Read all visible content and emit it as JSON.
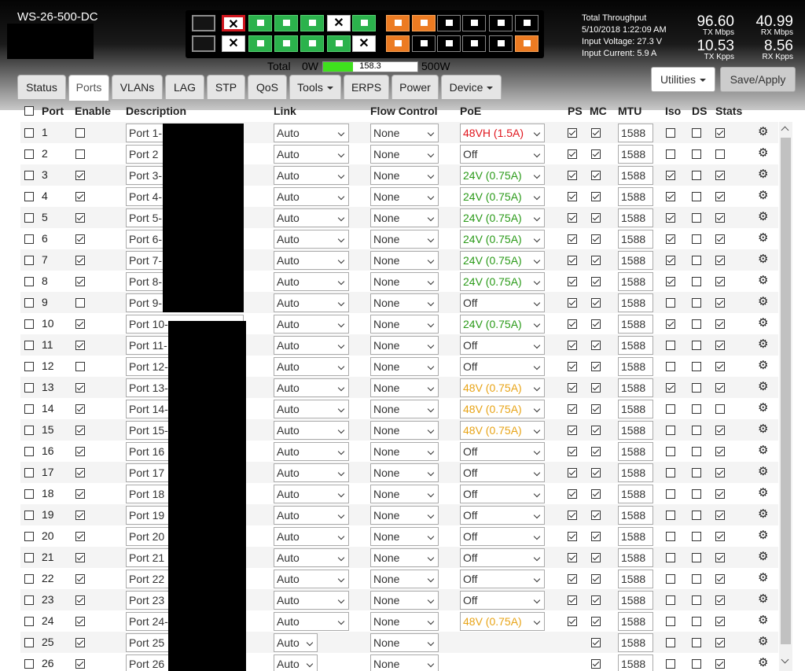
{
  "device": {
    "name": "WS-26-500-DC"
  },
  "port_icons": {
    "top": [
      "off",
      "x-red",
      "green",
      "green",
      "green",
      "x",
      "green",
      "orange",
      "orange",
      "black",
      "black",
      "black",
      "black"
    ],
    "bottom": [
      "off",
      "x",
      "green",
      "green",
      "green",
      "green",
      "x",
      "orange",
      "black",
      "black",
      "black",
      "black",
      "orange"
    ]
  },
  "power": {
    "total_label": "Total",
    "min_label": "0W",
    "value": "158.3",
    "max_label": "500W",
    "fraction": 0.3166
  },
  "throughput": {
    "title": "Total Throughput",
    "datetime": "5/10/2018 1:22:09 AM",
    "voltage": "Input Voltage: 27.3 V",
    "current": "Input Current: 5.9 A",
    "tx_mbps": "96.60",
    "tx_mbps_unit": "TX Mbps",
    "rx_mbps": "40.99",
    "rx_mbps_unit": "RX Mbps",
    "tx_kpps": "10.53",
    "tx_kpps_unit": "TX Kpps",
    "rx_kpps": "8.56",
    "rx_kpps_unit": "RX Kpps"
  },
  "buttons": {
    "utilities": "Utilities",
    "save": "Save/Apply"
  },
  "tabs": [
    {
      "label": "Status",
      "dropdown": false,
      "active": false
    },
    {
      "label": "Ports",
      "dropdown": false,
      "active": true
    },
    {
      "label": "VLANs",
      "dropdown": false,
      "active": false
    },
    {
      "label": "LAG",
      "dropdown": false,
      "active": false
    },
    {
      "label": "STP",
      "dropdown": false,
      "active": false
    },
    {
      "label": "QoS",
      "dropdown": false,
      "active": false
    },
    {
      "label": "Tools",
      "dropdown": true,
      "active": false
    },
    {
      "label": "ERPS",
      "dropdown": false,
      "active": false
    },
    {
      "label": "Power",
      "dropdown": false,
      "active": false
    },
    {
      "label": "Device",
      "dropdown": true,
      "active": false
    }
  ],
  "columns": {
    "port": "Port",
    "enable": "Enable",
    "description": "Description",
    "link": "Link",
    "flow": "Flow Control",
    "poe": "PoE",
    "ps": "PS",
    "mc": "MC",
    "mtu": "MTU",
    "iso": "Iso",
    "ds": "DS",
    "stats": "Stats"
  },
  "colors": {
    "poe_red": "#e0161e",
    "poe_green": "#2a9a18",
    "poe_amber": "#e8a417",
    "poe_off": "#333333"
  },
  "ports": [
    {
      "n": "1",
      "en": false,
      "desc": "Port 1-",
      "link": "Auto",
      "flow": "None",
      "poe": "48VH (1.5A)",
      "poe_c": "red",
      "ps": true,
      "mc": true,
      "mtu": "1588",
      "iso": false,
      "ds": false,
      "st": true
    },
    {
      "n": "2",
      "en": false,
      "desc": "Port 2",
      "link": "Auto",
      "flow": "None",
      "poe": "Off",
      "poe_c": "off",
      "ps": true,
      "mc": true,
      "mtu": "1588",
      "iso": false,
      "ds": false,
      "st": false
    },
    {
      "n": "3",
      "en": true,
      "desc": "Port 3-",
      "link": "Auto",
      "flow": "None",
      "poe": "24V (0.75A)",
      "poe_c": "green",
      "ps": true,
      "mc": true,
      "mtu": "1588",
      "iso": true,
      "ds": false,
      "st": true
    },
    {
      "n": "4",
      "en": true,
      "desc": "Port 4-",
      "link": "Auto",
      "flow": "None",
      "poe": "24V (0.75A)",
      "poe_c": "green",
      "ps": true,
      "mc": true,
      "mtu": "1588",
      "iso": true,
      "ds": false,
      "st": true
    },
    {
      "n": "5",
      "en": true,
      "desc": "Port 5-",
      "link": "Auto",
      "flow": "None",
      "poe": "24V (0.75A)",
      "poe_c": "green",
      "ps": true,
      "mc": true,
      "mtu": "1588",
      "iso": true,
      "ds": false,
      "st": true
    },
    {
      "n": "6",
      "en": true,
      "desc": "Port 6-",
      "link": "Auto",
      "flow": "None",
      "poe": "24V (0.75A)",
      "poe_c": "green",
      "ps": true,
      "mc": true,
      "mtu": "1588",
      "iso": true,
      "ds": false,
      "st": true
    },
    {
      "n": "7",
      "en": true,
      "desc": "Port 7-",
      "link": "Auto",
      "flow": "None",
      "poe": "24V (0.75A)",
      "poe_c": "green",
      "ps": true,
      "mc": true,
      "mtu": "1588",
      "iso": true,
      "ds": false,
      "st": true
    },
    {
      "n": "8",
      "en": true,
      "desc": "Port 8-",
      "link": "Auto",
      "flow": "None",
      "poe": "24V (0.75A)",
      "poe_c": "green",
      "ps": true,
      "mc": true,
      "mtu": "1588",
      "iso": true,
      "ds": false,
      "st": true
    },
    {
      "n": "9",
      "en": false,
      "desc": "Port 9-",
      "link": "Auto",
      "flow": "None",
      "poe": "Off",
      "poe_c": "off",
      "ps": true,
      "mc": true,
      "mtu": "1588",
      "iso": false,
      "ds": false,
      "st": true
    },
    {
      "n": "10",
      "en": true,
      "desc": "Port 10-",
      "link": "Auto",
      "flow": "None",
      "poe": "24V (0.75A)",
      "poe_c": "green",
      "ps": true,
      "mc": true,
      "mtu": "1588",
      "iso": true,
      "ds": false,
      "st": true
    },
    {
      "n": "11",
      "en": true,
      "desc": "Port 11-",
      "link": "Auto",
      "flow": "None",
      "poe": "Off",
      "poe_c": "off",
      "ps": true,
      "mc": true,
      "mtu": "1588",
      "iso": false,
      "ds": false,
      "st": true
    },
    {
      "n": "12",
      "en": false,
      "desc": "Port 12-",
      "link": "Auto",
      "flow": "None",
      "poe": "Off",
      "poe_c": "off",
      "ps": true,
      "mc": true,
      "mtu": "1588",
      "iso": false,
      "ds": false,
      "st": true
    },
    {
      "n": "13",
      "en": true,
      "desc": "Port 13-",
      "link": "Auto",
      "flow": "None",
      "poe": "48V (0.75A)",
      "poe_c": "amber",
      "ps": true,
      "mc": true,
      "mtu": "1588",
      "iso": true,
      "ds": false,
      "st": true
    },
    {
      "n": "14",
      "en": true,
      "desc": "Port 14-",
      "link": "Auto",
      "flow": "None",
      "poe": "48V (0.75A)",
      "poe_c": "amber",
      "ps": true,
      "mc": true,
      "mtu": "1588",
      "iso": false,
      "ds": false,
      "st": false
    },
    {
      "n": "15",
      "en": true,
      "desc": "Port 15-",
      "link": "Auto",
      "flow": "None",
      "poe": "48V (0.75A)",
      "poe_c": "amber",
      "ps": true,
      "mc": true,
      "mtu": "1588",
      "iso": false,
      "ds": false,
      "st": true
    },
    {
      "n": "16",
      "en": true,
      "desc": "Port 16",
      "link": "Auto",
      "flow": "None",
      "poe": "Off",
      "poe_c": "off",
      "ps": true,
      "mc": true,
      "mtu": "1588",
      "iso": false,
      "ds": false,
      "st": true
    },
    {
      "n": "17",
      "en": true,
      "desc": "Port 17",
      "link": "Auto",
      "flow": "None",
      "poe": "Off",
      "poe_c": "off",
      "ps": true,
      "mc": true,
      "mtu": "1588",
      "iso": false,
      "ds": false,
      "st": true
    },
    {
      "n": "18",
      "en": true,
      "desc": "Port 18",
      "link": "Auto",
      "flow": "None",
      "poe": "Off",
      "poe_c": "off",
      "ps": true,
      "mc": true,
      "mtu": "1588",
      "iso": false,
      "ds": false,
      "st": true
    },
    {
      "n": "19",
      "en": true,
      "desc": "Port 19",
      "link": "Auto",
      "flow": "None",
      "poe": "Off",
      "poe_c": "off",
      "ps": true,
      "mc": true,
      "mtu": "1588",
      "iso": false,
      "ds": false,
      "st": true
    },
    {
      "n": "20",
      "en": true,
      "desc": "Port 20",
      "link": "Auto",
      "flow": "None",
      "poe": "Off",
      "poe_c": "off",
      "ps": true,
      "mc": true,
      "mtu": "1588",
      "iso": false,
      "ds": false,
      "st": true
    },
    {
      "n": "21",
      "en": true,
      "desc": "Port 21",
      "link": "Auto",
      "flow": "None",
      "poe": "Off",
      "poe_c": "off",
      "ps": true,
      "mc": true,
      "mtu": "1588",
      "iso": false,
      "ds": false,
      "st": true
    },
    {
      "n": "22",
      "en": true,
      "desc": "Port 22",
      "link": "Auto",
      "flow": "None",
      "poe": "Off",
      "poe_c": "off",
      "ps": true,
      "mc": true,
      "mtu": "1588",
      "iso": false,
      "ds": false,
      "st": true
    },
    {
      "n": "23",
      "en": true,
      "desc": "Port 23",
      "link": "Auto",
      "flow": "None",
      "poe": "Off",
      "poe_c": "off",
      "ps": true,
      "mc": true,
      "mtu": "1588",
      "iso": false,
      "ds": false,
      "st": true
    },
    {
      "n": "24",
      "en": true,
      "desc": "Port 24-",
      "link": "Auto",
      "flow": "None",
      "poe": "48V (0.75A)",
      "poe_c": "amber",
      "ps": true,
      "mc": true,
      "mtu": "1588",
      "iso": false,
      "ds": false,
      "st": true
    },
    {
      "n": "25",
      "en": true,
      "desc": "Port 25",
      "link": "Auto",
      "flow": "None",
      "poe": "",
      "poe_c": "none",
      "ps": false,
      "mc": true,
      "mtu": "1588",
      "iso": false,
      "ds": false,
      "st": true
    },
    {
      "n": "26",
      "en": true,
      "desc": "Port 26",
      "link": "Auto",
      "flow": "None",
      "poe": "",
      "poe_c": "none",
      "ps": false,
      "mc": true,
      "mtu": "1588",
      "iso": false,
      "ds": false,
      "st": true
    }
  ]
}
